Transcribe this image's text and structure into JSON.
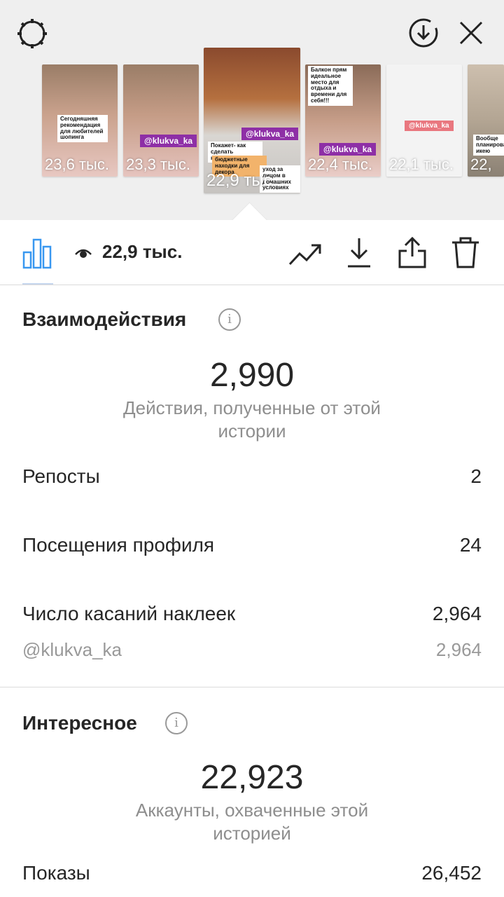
{
  "colors": {
    "accent": "#3897f0",
    "tag_purple": "#8e2fa6",
    "muted": "#8e8e8e"
  },
  "top": {
    "settings_icon": "gear-icon",
    "download_icon": "download-circle-icon",
    "close_icon": "close-icon",
    "thumbnails": [
      {
        "views": "23,6 тыс.",
        "note": "Сегодняшняя рекомендация для любителей шопинга",
        "tag": ""
      },
      {
        "views": "23,3 тыс.",
        "note": "",
        "tag": "@klukva_ka"
      },
      {
        "views": "22,9 тыс.",
        "note": "Покажет- как сделать квартиру уютнее",
        "tag": "@klukva_ka",
        "note2": "бюджетные находки для декора",
        "note3": "уход за лицом в домашних условиях"
      },
      {
        "views": "22,4 тыс.",
        "note": "Балкон прям идеальное место для отдыха и времени для себя!!!",
        "tag": "@klukva_ka"
      },
      {
        "views": "22,1 тыс.",
        "note": "",
        "tag": "@klukva_ka"
      },
      {
        "views": "22,",
        "note": "Вообще планирова икею",
        "tag": ""
      }
    ]
  },
  "toolbar": {
    "views": "22,9 тыс."
  },
  "interactions": {
    "title": "Взаимодействия",
    "total": "2,990",
    "caption": "Действия, полученные от этой истории",
    "rows": [
      {
        "label": "Репосты",
        "value": "2"
      },
      {
        "label": "Посещения профиля",
        "value": "24"
      },
      {
        "label": "Число касаний наклеек",
        "value": "2,964"
      }
    ],
    "sub": {
      "label": "@klukva_ka",
      "value": "2,964"
    }
  },
  "discovery": {
    "title": "Интересное",
    "total": "22,923",
    "caption": "Аккаунты, охваченные этой историей",
    "rows": [
      {
        "label": "Показы",
        "value": "26,452"
      }
    ]
  }
}
